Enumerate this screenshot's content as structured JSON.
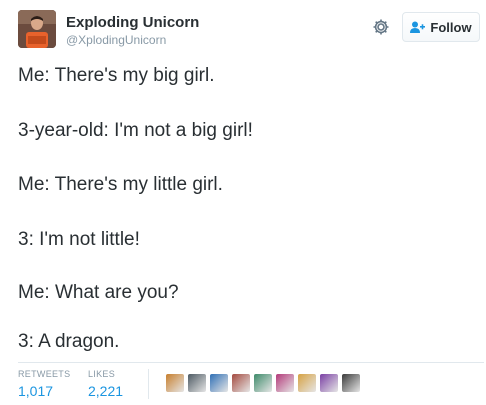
{
  "tweet": {
    "author": {
      "display_name": "Exploding Unicorn",
      "handle": "@XplodingUnicorn"
    },
    "actions": {
      "settings_icon": "gear-icon",
      "follow_label": "Follow",
      "follow_icon": "add-user-icon"
    },
    "lines": [
      "Me: There's my big girl.",
      "3-year-old: I'm not a big girl!",
      "Me: There's my little girl.",
      "3: I'm not little!",
      "Me: What are you?",
      "3: A dragon."
    ],
    "stats": {
      "retweets_label": "RETWEETS",
      "retweets_count": "1,017",
      "likes_label": "LIKES",
      "likes_count": "2,221"
    },
    "colors": {
      "text": "#292f33",
      "muted": "#8899a6",
      "link": "#1b95e0",
      "border": "#e1e8ed"
    },
    "likers": [
      {
        "name": "liker-avatar-1",
        "color": "#c77f2e"
      },
      {
        "name": "liker-avatar-2",
        "color": "#4d5a63"
      },
      {
        "name": "liker-avatar-3",
        "color": "#2f6fb5"
      },
      {
        "name": "liker-avatar-4",
        "color": "#a44a3f"
      },
      {
        "name": "liker-avatar-5",
        "color": "#3d8a6a"
      },
      {
        "name": "liker-avatar-6",
        "color": "#b33a7a"
      },
      {
        "name": "liker-avatar-7",
        "color": "#d6a243"
      },
      {
        "name": "liker-avatar-8",
        "color": "#7a3fa4"
      },
      {
        "name": "liker-avatar-9",
        "color": "#3a3a3a"
      }
    ]
  }
}
